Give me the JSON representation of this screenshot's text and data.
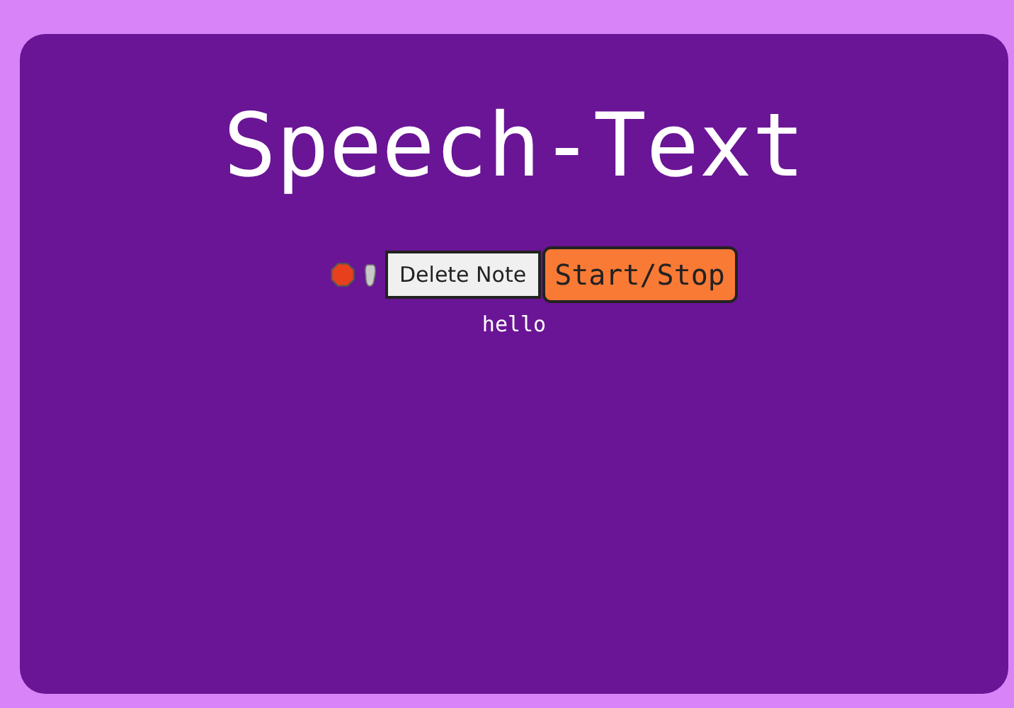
{
  "title": "Speech-Text",
  "controls": {
    "delete_button": "Delete Note",
    "toggle_button": "Start/Stop"
  },
  "transcript": "hello"
}
